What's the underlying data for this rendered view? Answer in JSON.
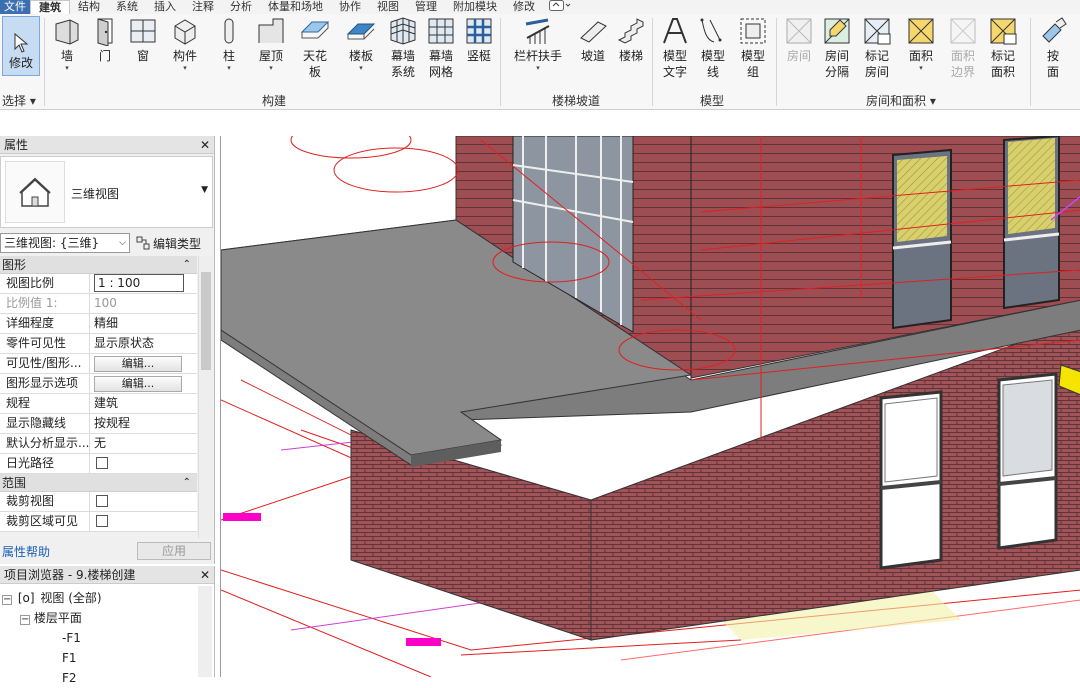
{
  "menu": [
    "文件",
    "建筑",
    "结构",
    "系统",
    "插入",
    "注释",
    "分析",
    "体量和场地",
    "协作",
    "视图",
    "管理",
    "附加模块",
    "修改"
  ],
  "ribbon": {
    "select": {
      "modify": "修改",
      "panel": "选择"
    },
    "build": {
      "items": [
        "墙",
        "门",
        "窗",
        "构件",
        "柱",
        "屋顶",
        "天花板",
        "楼板",
        "幕墙\n系统",
        "幕墙\n网格",
        "竖梃"
      ],
      "panel": "构建"
    },
    "stairs": {
      "items": [
        "栏杆扶手",
        "坡道",
        "楼梯"
      ],
      "panel": "楼梯坡道"
    },
    "model": {
      "items": [
        "模型\n文字",
        "模型\n线",
        "模型\n组"
      ],
      "panel": "模型"
    },
    "room": {
      "items": [
        "房间",
        "房间\n分隔",
        "标记\n房间",
        "面积",
        "面积\n边界",
        "标记\n面积"
      ],
      "panel": "房间和面积"
    },
    "extra": {
      "item": "按\n面"
    }
  },
  "properties": {
    "title": "属性",
    "type_name": "三维视图",
    "filter": "三维视图: {三维}",
    "edit_type": "编辑类型",
    "groups": {
      "graphics": "图形",
      "extents": "范围"
    },
    "rows": [
      {
        "k": "视图比例",
        "v": "1 : 100",
        "kind": "input"
      },
      {
        "k": "比例值 1:",
        "v": "100",
        "kind": "dim"
      },
      {
        "k": "详细程度",
        "v": "精细",
        "kind": "text"
      },
      {
        "k": "零件可见性",
        "v": "显示原状态",
        "kind": "text"
      },
      {
        "k": "可见性/图形...",
        "v": "编辑...",
        "kind": "button"
      },
      {
        "k": "图形显示选项",
        "v": "编辑...",
        "kind": "button"
      },
      {
        "k": "规程",
        "v": "建筑",
        "kind": "text"
      },
      {
        "k": "显示隐藏线",
        "v": "按规程",
        "kind": "text"
      },
      {
        "k": "默认分析显示...",
        "v": "无",
        "kind": "text"
      },
      {
        "k": "日光路径",
        "v": "",
        "kind": "check"
      }
    ],
    "rows2": [
      {
        "k": "裁剪视图",
        "v": "",
        "kind": "check"
      },
      {
        "k": "裁剪区域可见",
        "v": "",
        "kind": "check"
      }
    ],
    "help": "属性帮助",
    "apply": "应用"
  },
  "browser": {
    "title": "项目浏览器 - 9.楼梯创建",
    "tree": [
      {
        "label": "视图 (全部)",
        "level": 0
      },
      {
        "label": "楼层平面",
        "level": 1
      },
      {
        "label": "-F1",
        "level": 2
      },
      {
        "label": "F1",
        "level": 2
      },
      {
        "label": "F2",
        "level": 2
      }
    ]
  },
  "colors": {
    "accent": "#3a6fb0",
    "brick": "#9e4e52",
    "slab": "#7a7a7a",
    "redline": "#e02020"
  }
}
